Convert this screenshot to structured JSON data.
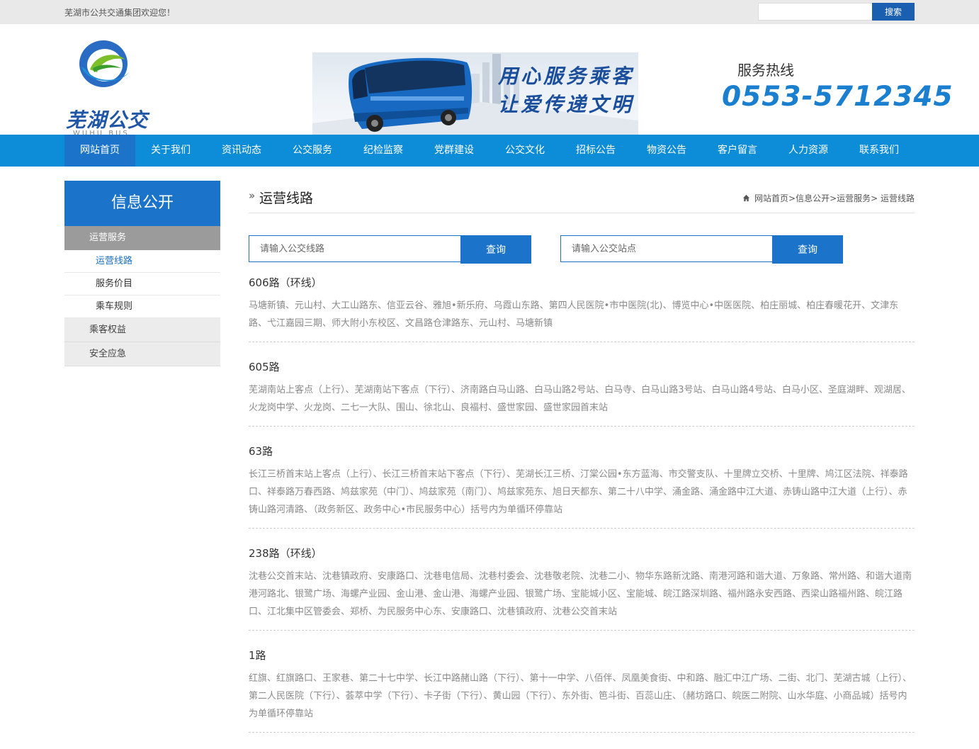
{
  "topbar": {
    "welcome": "芜湖市公共交通集团欢迎您！",
    "search_button": "搜索"
  },
  "header": {
    "logo_text": "芜湖公交",
    "logo_sub": "WUHU BUS",
    "slogan_line1": "用心服务乘客",
    "slogan_line2": "让爱传递文明",
    "hotline_label": "服务热线",
    "hotline_number": "0553-5712345"
  },
  "nav": [
    "网站首页",
    "关于我们",
    "资讯动态",
    "公交服务",
    "纪检监察",
    "党群建设",
    "公交文化",
    "招标公告",
    "物资公告",
    "客户留言",
    "人力资源",
    "联系我们"
  ],
  "sidebar": {
    "title": "信息公开",
    "category1": "运营服务",
    "sub_items": [
      "运营线路",
      "服务价目",
      "乘车规则"
    ],
    "category2": "乘客权益",
    "category3": "安全应急"
  },
  "content": {
    "title": "运营线路",
    "breadcrumb": "网站首页>信息公开>运营服务> 运营线路",
    "search_line_placeholder": "请输入公交线路",
    "search_stop_placeholder": "请输入公交站点",
    "query_label": "查询"
  },
  "routes": [
    {
      "name": "606路（环线）",
      "stops": "马塘新镇、元山村、大工山路东、信亚云谷、雅旭•新乐府、乌霞山东路、第四人民医院•市中医院(北)、博览中心•中医医院、柏庄丽城、柏庄春暖花开、文津东路、弋江嘉园三期、师大附小东校区、文昌路仓津路东、元山村、马塘新镇"
    },
    {
      "name": "605路",
      "stops": "芜湖南站上客点（上行）、芜湖南站下客点（下行）、济南路白马山路、白马山路2号站、白马寺、白马山路3号站、白马山路4号站、白马小区、圣庭湖畔、观湖居、火龙岗中学、火龙岗、二七一大队、围山、徐北山、良福村、盛世家园、盛世家园首末站"
    },
    {
      "name": "63路",
      "stops": "长江三桥首末站上客点（上行）、长江三桥首末站下客点（下行）、芜湖长江三桥、汀棠公园•东方蓝海、市交警支队、十里牌立交桥、十里牌、鸠江区法院、祥泰路口、祥泰路万春西路、鸠兹家苑（中门）、鸠兹家苑（南门）、鸠兹家苑东、旭日天都东、第二十八中学、涌金路、涌金路中江大道、赤铸山路中江大道（上行）、赤铸山路河清路、（政务新区、政务中心•市民服务中心）括号内为单循环停靠站"
    },
    {
      "name": "238路（环线）",
      "stops": "沈巷公交首末站、沈巷镇政府、安康路口、沈巷电信局、沈巷村委会、沈巷敬老院、沈巷二小、物华东路新沈路、南港河路和谐大道、万象路、常州路、和谐大道南港河路北、银鹭广场、海螺产业园、金山港、金山港、海螺产业园、银鹭广场、宝能城小区、宝能城、皖江路深圳路、福州路永安西路、西梁山路福州路、皖江路口、江北集中区管委会、郑桥、为民服务中心东、安康路口、沈巷镇政府、沈巷公交首末站"
    },
    {
      "name": "1路",
      "stops": "红旗、红旗路口、王家巷、第二十七中学、长江中路赭山路（下行）、第十一中学、八佰伴、凤凰美食街、中和路、融汇中江广场、二街、北门、芜湖古城（上行）、第二人民医院（下行）、荟萃中学（下行）、卡子街（下行）、黄山园（下行）、东外街、笆斗街、百蕊山庄、（赭坊路口、皖医二附院、山水华庭、小商品城）括号内为单循环停靠站"
    }
  ]
}
